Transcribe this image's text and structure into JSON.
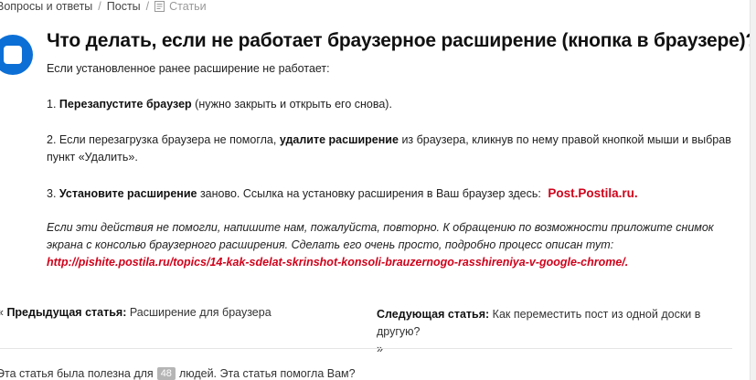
{
  "breadcrumb": {
    "item1": "Вопросы и ответы",
    "item2": "Посты",
    "separator": "/",
    "current": "Статьи"
  },
  "article": {
    "title": "Что делать, если не работает браузерное расширение (кнопка в браузере)?",
    "intro": "Если установленное ранее расширение не работает:",
    "step1": {
      "num": "1.",
      "bold": "Перезапустите браузер",
      "rest": "(нужно закрыть и открыть его снова)."
    },
    "step2": {
      "pre": "2. Если перезагрузка браузера не помогла,",
      "bold": "удалите расширение",
      "rest": "из браузера, кликнув по нему правой кнопкой мыши и выбрав пункт «Удалить»."
    },
    "step3": {
      "num": "3.",
      "bold": "Установите расширение",
      "rest": "заново. Ссылка на установку расширения в Ваш браузер здесь:",
      "link": "Post.Postila.ru."
    },
    "note": {
      "text": "Если эти действия не помогли, напишите нам, пожалуйста, повторно. К обращению по возможности приложите снимок экрана с консолью браузерного расширения. Сделать его очень просто, подробно процесс описан тут:",
      "link": "http://pishite.postila.ru/topics/14-kak-sdelat-skrinshot-konsoli-brauzernogo-rasshireniya-v-google-chrome/."
    }
  },
  "navigation": {
    "prev_arrow": "«",
    "prev_label": "Предыдущая статья:",
    "prev_title": "Расширение для браузера",
    "next_label": "Следующая статья:",
    "next_title": "Как переместить пост из одной доски в другую?",
    "next_arrow": "»"
  },
  "feedback": {
    "text_before": "Эта статья была полезна для",
    "count": "48",
    "text_after": "людей. Эта статья помогла Вам?"
  },
  "colors": {
    "accent_blue": "#0c6fd6",
    "link_red": "#d0021b"
  }
}
